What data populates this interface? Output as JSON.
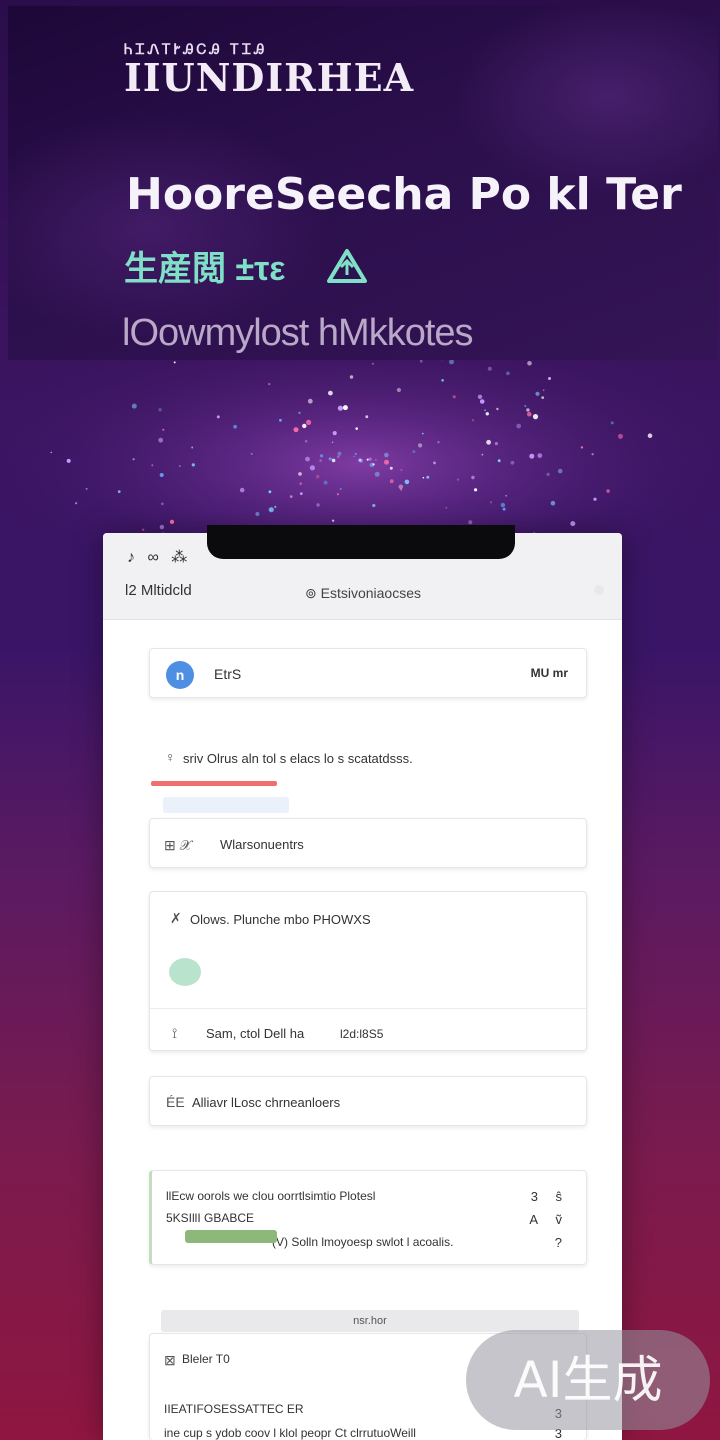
{
  "hero": {
    "brand_small": "ᏂᏆᏁᎢᎨᎯᏟᎯ ᎢᏆᎯ",
    "brand_big": "IIUNDIRHEA",
    "title": "HooreSeecha Po kl Ter",
    "subtitle": "生産閲 ±τε",
    "tagline": "lOowmylost hMkkotes"
  },
  "phone": {
    "status_icons": "♪ ∞ ⁂",
    "status_left": "l2 Mltidcld",
    "status_center": "⊚ Estsivoniaocses"
  },
  "rows": {
    "user": {
      "avatar": "n",
      "name": "EtrS",
      "value": "MU mr"
    },
    "notice": {
      "icon": "♀",
      "text": "sriv Olrus aln tol s elacs lo s scatatdsss."
    },
    "welcome": {
      "icon": "⊞ 𝒳",
      "text": "Wlarsonuentrs"
    },
    "options": {
      "icon": "✗",
      "text": "Olows. Plunche mbo PHOWXS"
    },
    "sam": {
      "icon": "⟟",
      "text": "Sam, ctol Dell ha",
      "value": "l2d:l8S5"
    },
    "allow": {
      "icon": "ÉE",
      "text": "Alliavr lLosc chrneanloers"
    },
    "detail": {
      "line1": "llEcw oorols we clou oorrtlsimtio Plotesl",
      "line2": "5KSIllI GBABCE",
      "line3": "(V) Solln lmoyoesp swlot l acoalis.",
      "side": [
        "3",
        "A",
        "?"
      ],
      "side_marks": [
        "ŝ",
        "ṽ"
      ]
    },
    "section": {
      "header": "nsr.hor",
      "item_icon": "⊠",
      "item_text": "Bleler T0",
      "subheading": "IIEATIFOSESSATTEC ER",
      "side": "3",
      "footer_text": "ine cup s ydob coov l klol peopr Ct clrrutuoWeill",
      "footer_side": "3"
    }
  },
  "watermark": "AI生成"
}
